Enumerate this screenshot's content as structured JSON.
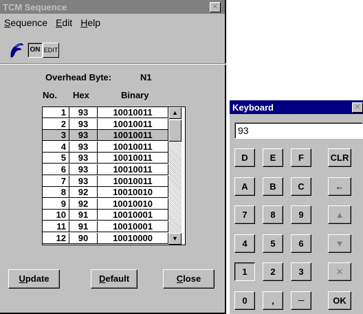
{
  "tcm": {
    "title": "TCM Sequence",
    "close_glyph": "✕",
    "menu": [
      {
        "key": "S",
        "rest": "equence"
      },
      {
        "key": "E",
        "rest": "dit"
      },
      {
        "key": "H",
        "rest": "elp"
      }
    ],
    "toolbar": {
      "on_label": "ON",
      "edit_label": "EDIT"
    },
    "overhead_label": "Overhead Byte:",
    "overhead_value": "N1",
    "columns": {
      "no": "No.",
      "hex": "Hex",
      "binary": "Binary"
    },
    "rows": [
      {
        "no": "1",
        "hex": "93",
        "binary": "10010011"
      },
      {
        "no": "2",
        "hex": "93",
        "binary": "10010011"
      },
      {
        "no": "3",
        "hex": "93",
        "binary": "10010011"
      },
      {
        "no": "4",
        "hex": "93",
        "binary": "10010011"
      },
      {
        "no": "5",
        "hex": "93",
        "binary": "10010011"
      },
      {
        "no": "6",
        "hex": "93",
        "binary": "10010011"
      },
      {
        "no": "7",
        "hex": "93",
        "binary": "10010011"
      },
      {
        "no": "8",
        "hex": "92",
        "binary": "10010010"
      },
      {
        "no": "9",
        "hex": "92",
        "binary": "10010010"
      },
      {
        "no": "10",
        "hex": "91",
        "binary": "10010001"
      },
      {
        "no": "11",
        "hex": "91",
        "binary": "10010001"
      },
      {
        "no": "12",
        "hex": "90",
        "binary": "10010000"
      }
    ],
    "selected_row": 3,
    "scroll_up": "▲",
    "scroll_down": "▼",
    "buttons": {
      "update": {
        "key": "U",
        "rest": "pdate"
      },
      "default": {
        "key": "D",
        "rest": "efault"
      },
      "close": {
        "key": "C",
        "rest": "lose"
      }
    }
  },
  "keyboard": {
    "title": "Keyboard",
    "close_glyph": "✕",
    "display_value": "93",
    "keys": {
      "d": "D",
      "e": "E",
      "f": "F",
      "clr": "CLR",
      "a": "A",
      "b": "B",
      "c": "C",
      "back": "←",
      "k7": "7",
      "k8": "8",
      "k9": "9",
      "up": "▲",
      "k4": "4",
      "k5": "5",
      "k6": "6",
      "down": "▼",
      "k1": "1",
      "k2": "2",
      "k3": "3",
      "cancel": "✕",
      "k0": "0",
      "dot": ",",
      "dash": "—",
      "ok": "OK"
    }
  }
}
